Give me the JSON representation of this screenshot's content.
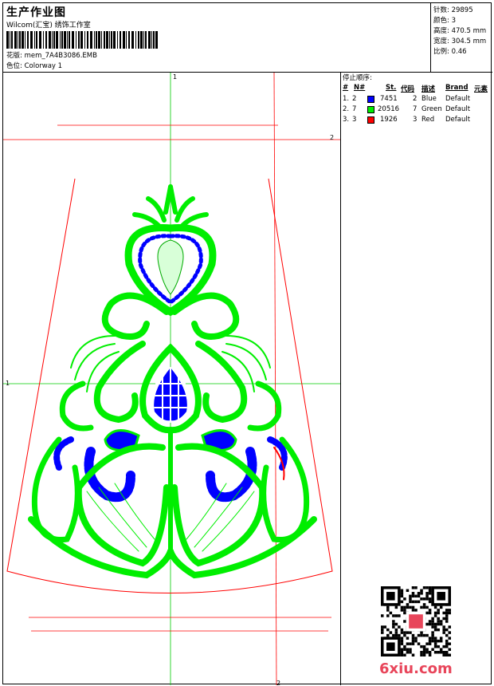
{
  "header": {
    "title": "生产作业图",
    "studio": "Wilcom(汇宝) 绣饰工作室",
    "design_label": "花版:",
    "design_name": "mem_7A4B3086.EMB",
    "colorway_label": "色位:",
    "colorway_name": "Colorway 1"
  },
  "stats": [
    {
      "label": "针数:",
      "value": "29895"
    },
    {
      "label": "颜色:",
      "value": "3"
    },
    {
      "label": "高度:",
      "value": "470.5 mm"
    },
    {
      "label": "宽度:",
      "value": "304.5 mm"
    },
    {
      "label": "比例:",
      "value": "0.46"
    }
  ],
  "sequence": {
    "title": "停止顺序:",
    "headers": [
      "#",
      "N#",
      "St.",
      "代码",
      "描述",
      "Brand",
      "元素"
    ],
    "rows": [
      {
        "n": "1.",
        "nn": "2",
        "color": "#0000ff",
        "st": "7451",
        "code": "2",
        "desc": "Blue",
        "brand": "Default"
      },
      {
        "n": "2.",
        "nn": "7",
        "color": "#00ee00",
        "st": "20516",
        "code": "7",
        "desc": "Green",
        "brand": "Default"
      },
      {
        "n": "3.",
        "nn": "3",
        "color": "#ff0000",
        "st": "1926",
        "code": "3",
        "desc": "Red",
        "brand": "Default"
      }
    ]
  },
  "guides": {
    "vertical_label": "1",
    "horizontal_label": "1",
    "red_label": "2"
  },
  "colors": {
    "blue": "#0000ff",
    "green": "#00ee00",
    "red": "#ff0000",
    "logo": "#e8455a"
  },
  "watermark": "6xiu.com"
}
